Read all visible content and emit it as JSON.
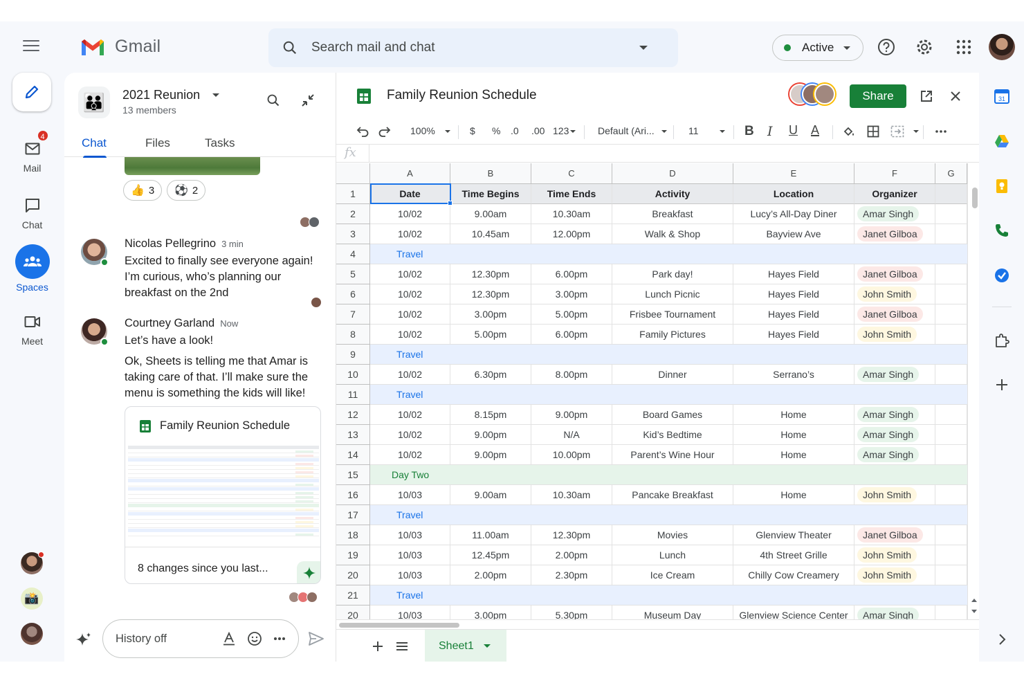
{
  "app": {
    "name": "Gmail",
    "search_placeholder": "Search mail and chat",
    "status": "Active",
    "colors": {
      "accent": "#0b57d0",
      "brand_red": "#EA4335",
      "sheets_green": "#188038"
    }
  },
  "rail": {
    "mail_label": "Mail",
    "mail_badge": "4",
    "chat_label": "Chat",
    "spaces_label": "Spaces",
    "meet_label": "Meet"
  },
  "space": {
    "name": "2021 Reunion",
    "members": "13 members",
    "tabs": [
      "Chat",
      "Files",
      "Tasks"
    ],
    "reactions": [
      {
        "emoji": "👍",
        "count": "3"
      },
      {
        "emoji": "⚽",
        "count": "2"
      }
    ],
    "messages": [
      {
        "author": "Nicolas Pellegrino",
        "time": "3 min",
        "text": "Excited to finally see everyone again! I’m curious, who’s planning our breakfast on the 2nd"
      },
      {
        "author": "Courtney Garland",
        "time": "Now",
        "text1": "Let’s have a look!",
        "text2": "Ok, Sheets is telling me that Amar is taking care of that. I’ll make sure the menu is something the kids will like!"
      }
    ],
    "card": {
      "title": "Family Reunion Schedule",
      "footer": "8 changes since you last..."
    },
    "compose_placeholder": "History off"
  },
  "sheet": {
    "title": "Family Reunion Schedule",
    "share_label": "Share",
    "toolbar": {
      "zoom": "100%",
      "currency": "$",
      "percent": "%",
      "dec_decrease": ".0",
      "dec_increase": ".00",
      "number_format": "123",
      "font": "Default (Ari...",
      "font_size": "11",
      "bold": "B",
      "italic": "I",
      "underline": "U",
      "text_color": "A"
    },
    "fx": "fx",
    "columns": [
      "A",
      "B",
      "C",
      "D",
      "E",
      "F",
      "G"
    ],
    "headers": [
      "Date",
      "Time Begins",
      "Time Ends",
      "Activity",
      "Location",
      "Organizer"
    ],
    "rows": [
      {
        "n": "1",
        "type": "header"
      },
      {
        "n": "2",
        "type": "data",
        "cells": [
          "10/02",
          "9.00am",
          "10.30am",
          "Breakfast",
          "Lucy’s All-Day Diner",
          "Amar Singh"
        ]
      },
      {
        "n": "3",
        "type": "data",
        "cells": [
          "10/02",
          "10.45am",
          "12.00pm",
          "Walk & Shop",
          "Bayview Ave",
          "Janet Gilboa"
        ]
      },
      {
        "n": "4",
        "type": "travel",
        "label": "Travel"
      },
      {
        "n": "5",
        "type": "data",
        "cells": [
          "10/02",
          "12.30pm",
          "6.00pm",
          "Park day!",
          "Hayes Field",
          "Janet Gilboa"
        ]
      },
      {
        "n": "6",
        "type": "data",
        "cells": [
          "10/02",
          "12.30pm",
          "3.00pm",
          "Lunch Picnic",
          "Hayes Field",
          "John Smith"
        ]
      },
      {
        "n": "7",
        "type": "data",
        "cells": [
          "10/02",
          "3.00pm",
          "5.00pm",
          "Frisbee Tournament",
          "Hayes Field",
          "Janet Gilboa"
        ]
      },
      {
        "n": "8",
        "type": "data",
        "cells": [
          "10/02",
          "5.00pm",
          "6.00pm",
          "Family Pictures",
          "Hayes Field",
          "John Smith"
        ]
      },
      {
        "n": "9",
        "type": "travel",
        "label": "Travel"
      },
      {
        "n": "10",
        "type": "data",
        "cells": [
          "10/02",
          "6.30pm",
          "8.00pm",
          "Dinner",
          "Serrano’s",
          "Amar Singh"
        ]
      },
      {
        "n": "11",
        "type": "travel",
        "label": "Travel"
      },
      {
        "n": "12",
        "type": "data",
        "cells": [
          "10/02",
          "8.15pm",
          "9.00pm",
          "Board Games",
          "Home",
          "Amar Singh"
        ]
      },
      {
        "n": "13",
        "type": "data",
        "cells": [
          "10/02",
          "9.00pm",
          "N/A",
          "Kid’s Bedtime",
          "Home",
          "Amar Singh"
        ]
      },
      {
        "n": "14",
        "type": "data",
        "cells": [
          "10/02",
          "9.00pm",
          "10.00pm",
          "Parent’s Wine Hour",
          "Home",
          "Amar Singh"
        ]
      },
      {
        "n": "15",
        "type": "daytwo",
        "label": "Day Two"
      },
      {
        "n": "16",
        "type": "data",
        "cells": [
          "10/03",
          "9.00am",
          "10.30am",
          "Pancake Breakfast",
          "Home",
          "John Smith"
        ]
      },
      {
        "n": "17",
        "type": "travel",
        "label": "Travel"
      },
      {
        "n": "18",
        "type": "data",
        "cells": [
          "10/03",
          "11.00am",
          "12.30pm",
          "Movies",
          "Glenview Theater",
          "Janet Gilboa"
        ]
      },
      {
        "n": "19",
        "type": "data",
        "cells": [
          "10/03",
          "12.45pm",
          "2.00pm",
          "Lunch",
          "4th Street Grille",
          "John Smith"
        ]
      },
      {
        "n": "20",
        "type": "data",
        "cells": [
          "10/03",
          "2.00pm",
          "2.30pm",
          "Ice Cream",
          "Chilly Cow Creamery",
          "John Smith"
        ]
      },
      {
        "n": "21",
        "type": "travel",
        "label": "Travel"
      },
      {
        "n": "20",
        "type": "data",
        "cells": [
          "10/03",
          "3.00pm",
          "5.30pm",
          "Museum Day",
          "Glenview Science Center",
          "Amar Singh"
        ]
      }
    ],
    "organizer_colors": {
      "Amar Singh": "#e6f4ea",
      "Janet Gilboa": "#fce8e6",
      "John Smith": "#fef7e0"
    },
    "sheet_tab": "Sheet1"
  }
}
